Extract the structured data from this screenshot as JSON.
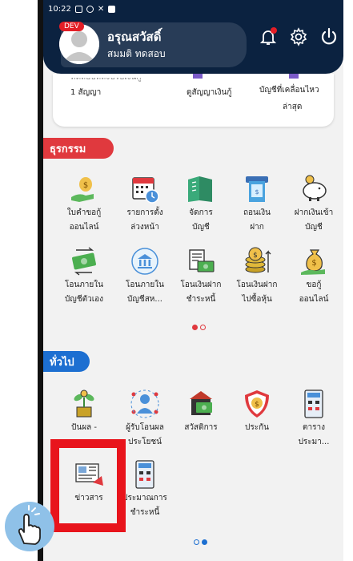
{
  "status_bar": {
    "time": "10:22"
  },
  "header": {
    "dev_badge": "DEV",
    "greeting": "อรุณสวัสดิ์",
    "user_name": "สมมติ ทดสอบ"
  },
  "top_card": {
    "cut_text": "ทดสอบหลังปรับเงินกู้",
    "contracts": "1 สัญญา",
    "loan_link": "ดูสัญญาเงินกู้",
    "movement_line1": "บัญชีที่เคลื่อนไหว",
    "movement_line2": "ล่าสุด"
  },
  "transactions": {
    "title": "ธุรกรรม",
    "items": [
      {
        "line1": "ใบคำขอกู้",
        "line2": "ออนไลน์",
        "icon": "loan-request-icon"
      },
      {
        "line1": "รายการตั้ง",
        "line2": "ล่วงหน้า",
        "icon": "calendar-clock-icon"
      },
      {
        "line1": "จัดการ",
        "line2": "บัญชี",
        "icon": "account-book-icon"
      },
      {
        "line1": "ถอนเงิน",
        "line2": "ฝาก",
        "icon": "atm-withdraw-icon"
      },
      {
        "line1": "ฝากเงินเข้า",
        "line2": "บัญชี",
        "icon": "piggy-bank-icon"
      },
      {
        "line1": "โอนภายใน",
        "line2": "บัญชีตัวเอง",
        "icon": "transfer-own-icon"
      },
      {
        "line1": "โอนภายใน",
        "line2": "บัญชีสห...",
        "icon": "bank-transfer-icon"
      },
      {
        "line1": "โอนเงินฝาก",
        "line2": "ชำระหนี้",
        "icon": "bill-payment-icon"
      },
      {
        "line1": "โอนเงินฝาก",
        "line2": "ไปซื้อหุ้น",
        "icon": "coin-stack-icon"
      },
      {
        "line1": "ขอกู้",
        "line2": "ออนไลน์",
        "icon": "money-bag-icon"
      }
    ]
  },
  "general": {
    "title": "ทั่วไป",
    "items": [
      {
        "line1": "ปันผล -",
        "line2": "",
        "icon": "dividend-plant-icon"
      },
      {
        "line1": "ผู้รับโอนผล",
        "line2": "ประโยชน์",
        "icon": "beneficiary-icon"
      },
      {
        "line1": "สวัสดิการ",
        "line2": "",
        "icon": "welfare-icon"
      },
      {
        "line1": "ประกัน",
        "line2": "",
        "icon": "insurance-shield-icon"
      },
      {
        "line1": "ตาราง",
        "line2": "ประมา...",
        "icon": "schedule-calculator-icon"
      },
      {
        "line1": "ข่าวสาร",
        "line2": "",
        "icon": "news-icon"
      },
      {
        "line1": "ประมาณการ",
        "line2": "ชำระหนี้",
        "icon": "calculator-icon"
      }
    ]
  },
  "colors": {
    "header": "#0b2240",
    "accent_red": "#e0393e",
    "accent_blue": "#1d6fd1",
    "highlight": "#e8141c"
  }
}
